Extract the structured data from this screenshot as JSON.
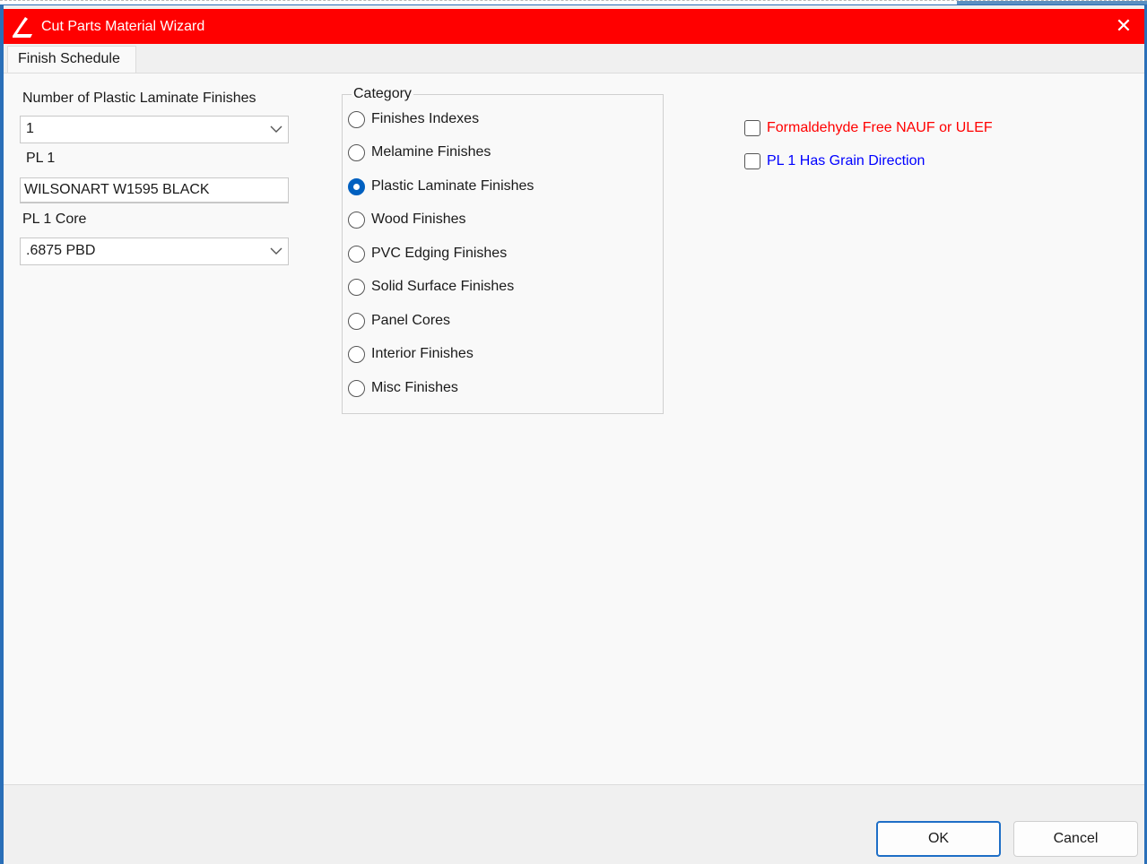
{
  "window": {
    "title": "Cut Parts Material Wizard",
    "close_glyph": "✕",
    "title_bar_color": "#ff0000",
    "icon": "app-logo-icon"
  },
  "tabs": [
    {
      "label": "Finish Schedule",
      "active": true
    }
  ],
  "form": {
    "count_label": "Number of Plastic Laminate Finishes",
    "count_value": "1",
    "pl1_label": "PL 1",
    "pl1_value": "WILSONART W1595 BLACK",
    "core_label": "PL 1 Core",
    "core_value": ".6875 PBD"
  },
  "category": {
    "legend": "Category",
    "options": [
      {
        "label": "Finishes Indexes",
        "selected": false
      },
      {
        "label": "Melamine Finishes",
        "selected": false
      },
      {
        "label": "Plastic Laminate Finishes",
        "selected": true
      },
      {
        "label": "Wood Finishes",
        "selected": false
      },
      {
        "label": "PVC Edging Finishes",
        "selected": false
      },
      {
        "label": "Solid Surface Finishes",
        "selected": false
      },
      {
        "label": "Panel Cores",
        "selected": false
      },
      {
        "label": "Interior Finishes",
        "selected": false
      },
      {
        "label": "Misc Finishes",
        "selected": false
      }
    ]
  },
  "options": {
    "formaldehyde": {
      "label": "Formaldehyde Free NAUF or ULEF",
      "checked": false,
      "color": "#ff0000"
    },
    "grain": {
      "label": "PL 1 Has Grain Direction",
      "checked": false,
      "color": "#0000ff"
    }
  },
  "buttons": {
    "ok": "OK",
    "cancel": "Cancel"
  }
}
